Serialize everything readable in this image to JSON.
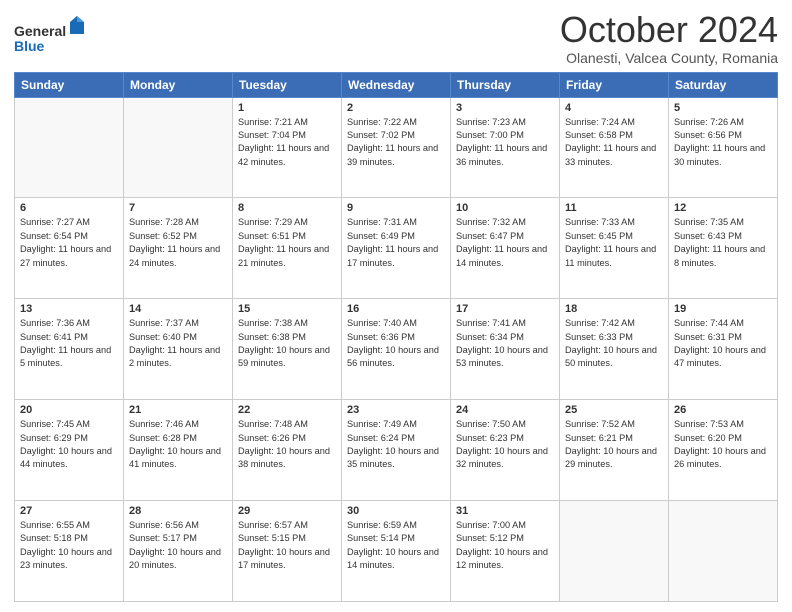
{
  "header": {
    "logo_line1": "General",
    "logo_line2": "Blue",
    "month": "October 2024",
    "location": "Olanesti, Valcea County, Romania"
  },
  "weekdays": [
    "Sunday",
    "Monday",
    "Tuesday",
    "Wednesday",
    "Thursday",
    "Friday",
    "Saturday"
  ],
  "weeks": [
    [
      {
        "day": "",
        "detail": ""
      },
      {
        "day": "",
        "detail": ""
      },
      {
        "day": "1",
        "detail": "Sunrise: 7:21 AM\nSunset: 7:04 PM\nDaylight: 11 hours and 42 minutes."
      },
      {
        "day": "2",
        "detail": "Sunrise: 7:22 AM\nSunset: 7:02 PM\nDaylight: 11 hours and 39 minutes."
      },
      {
        "day": "3",
        "detail": "Sunrise: 7:23 AM\nSunset: 7:00 PM\nDaylight: 11 hours and 36 minutes."
      },
      {
        "day": "4",
        "detail": "Sunrise: 7:24 AM\nSunset: 6:58 PM\nDaylight: 11 hours and 33 minutes."
      },
      {
        "day": "5",
        "detail": "Sunrise: 7:26 AM\nSunset: 6:56 PM\nDaylight: 11 hours and 30 minutes."
      }
    ],
    [
      {
        "day": "6",
        "detail": "Sunrise: 7:27 AM\nSunset: 6:54 PM\nDaylight: 11 hours and 27 minutes."
      },
      {
        "day": "7",
        "detail": "Sunrise: 7:28 AM\nSunset: 6:52 PM\nDaylight: 11 hours and 24 minutes."
      },
      {
        "day": "8",
        "detail": "Sunrise: 7:29 AM\nSunset: 6:51 PM\nDaylight: 11 hours and 21 minutes."
      },
      {
        "day": "9",
        "detail": "Sunrise: 7:31 AM\nSunset: 6:49 PM\nDaylight: 11 hours and 17 minutes."
      },
      {
        "day": "10",
        "detail": "Sunrise: 7:32 AM\nSunset: 6:47 PM\nDaylight: 11 hours and 14 minutes."
      },
      {
        "day": "11",
        "detail": "Sunrise: 7:33 AM\nSunset: 6:45 PM\nDaylight: 11 hours and 11 minutes."
      },
      {
        "day": "12",
        "detail": "Sunrise: 7:35 AM\nSunset: 6:43 PM\nDaylight: 11 hours and 8 minutes."
      }
    ],
    [
      {
        "day": "13",
        "detail": "Sunrise: 7:36 AM\nSunset: 6:41 PM\nDaylight: 11 hours and 5 minutes."
      },
      {
        "day": "14",
        "detail": "Sunrise: 7:37 AM\nSunset: 6:40 PM\nDaylight: 11 hours and 2 minutes."
      },
      {
        "day": "15",
        "detail": "Sunrise: 7:38 AM\nSunset: 6:38 PM\nDaylight: 10 hours and 59 minutes."
      },
      {
        "day": "16",
        "detail": "Sunrise: 7:40 AM\nSunset: 6:36 PM\nDaylight: 10 hours and 56 minutes."
      },
      {
        "day": "17",
        "detail": "Sunrise: 7:41 AM\nSunset: 6:34 PM\nDaylight: 10 hours and 53 minutes."
      },
      {
        "day": "18",
        "detail": "Sunrise: 7:42 AM\nSunset: 6:33 PM\nDaylight: 10 hours and 50 minutes."
      },
      {
        "day": "19",
        "detail": "Sunrise: 7:44 AM\nSunset: 6:31 PM\nDaylight: 10 hours and 47 minutes."
      }
    ],
    [
      {
        "day": "20",
        "detail": "Sunrise: 7:45 AM\nSunset: 6:29 PM\nDaylight: 10 hours and 44 minutes."
      },
      {
        "day": "21",
        "detail": "Sunrise: 7:46 AM\nSunset: 6:28 PM\nDaylight: 10 hours and 41 minutes."
      },
      {
        "day": "22",
        "detail": "Sunrise: 7:48 AM\nSunset: 6:26 PM\nDaylight: 10 hours and 38 minutes."
      },
      {
        "day": "23",
        "detail": "Sunrise: 7:49 AM\nSunset: 6:24 PM\nDaylight: 10 hours and 35 minutes."
      },
      {
        "day": "24",
        "detail": "Sunrise: 7:50 AM\nSunset: 6:23 PM\nDaylight: 10 hours and 32 minutes."
      },
      {
        "day": "25",
        "detail": "Sunrise: 7:52 AM\nSunset: 6:21 PM\nDaylight: 10 hours and 29 minutes."
      },
      {
        "day": "26",
        "detail": "Sunrise: 7:53 AM\nSunset: 6:20 PM\nDaylight: 10 hours and 26 minutes."
      }
    ],
    [
      {
        "day": "27",
        "detail": "Sunrise: 6:55 AM\nSunset: 5:18 PM\nDaylight: 10 hours and 23 minutes."
      },
      {
        "day": "28",
        "detail": "Sunrise: 6:56 AM\nSunset: 5:17 PM\nDaylight: 10 hours and 20 minutes."
      },
      {
        "day": "29",
        "detail": "Sunrise: 6:57 AM\nSunset: 5:15 PM\nDaylight: 10 hours and 17 minutes."
      },
      {
        "day": "30",
        "detail": "Sunrise: 6:59 AM\nSunset: 5:14 PM\nDaylight: 10 hours and 14 minutes."
      },
      {
        "day": "31",
        "detail": "Sunrise: 7:00 AM\nSunset: 5:12 PM\nDaylight: 10 hours and 12 minutes."
      },
      {
        "day": "",
        "detail": ""
      },
      {
        "day": "",
        "detail": ""
      }
    ]
  ]
}
